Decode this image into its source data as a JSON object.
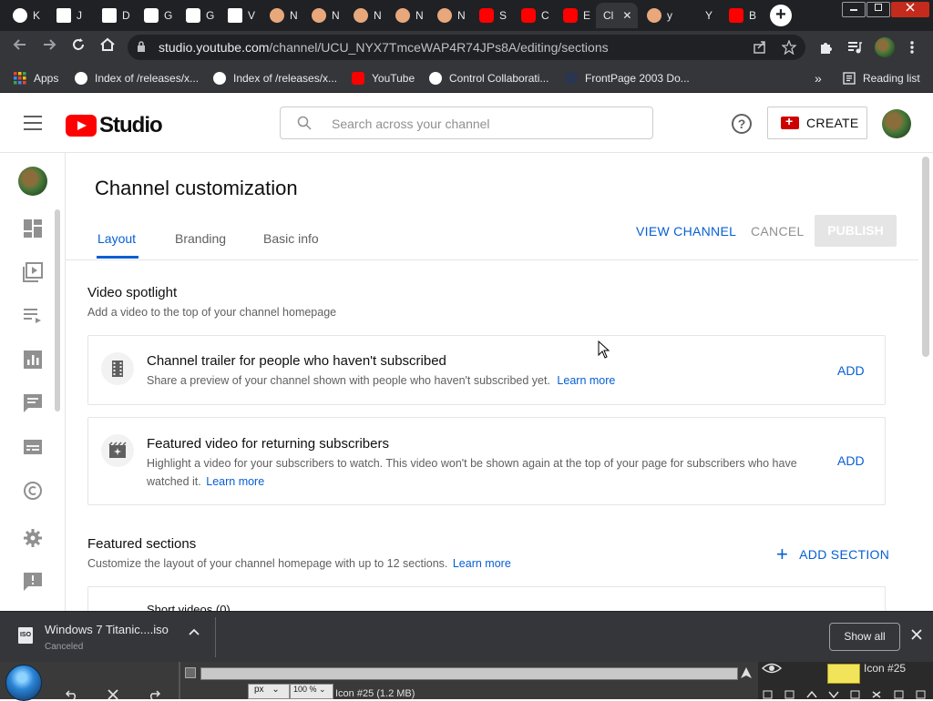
{
  "browser": {
    "tabs": [
      {
        "label": "K",
        "color": "#ffffff"
      },
      {
        "label": "J",
        "color": "#ffffff"
      },
      {
        "label": "D",
        "color": "#ffffff"
      },
      {
        "label": "G",
        "color": "#ffffff"
      },
      {
        "label": "G",
        "color": "#ffffff"
      },
      {
        "label": "V",
        "color": "#ffffff"
      },
      {
        "label": "N",
        "color": "#e8a87c"
      },
      {
        "label": "N",
        "color": "#e8a87c"
      },
      {
        "label": "N",
        "color": "#e8a87c"
      },
      {
        "label": "N",
        "color": "#e8a87c"
      },
      {
        "label": "N",
        "color": "#e8a87c"
      },
      {
        "label": "S",
        "color": "#ff0000"
      },
      {
        "label": "C",
        "color": "#ff0000"
      },
      {
        "label": "E",
        "color": "#ff0000"
      },
      {
        "label": "Cl",
        "color": "#ff0000"
      },
      {
        "label": "y",
        "color": "#e8a87c"
      },
      {
        "label": "Y",
        "color": "#202124"
      },
      {
        "label": "B",
        "color": "#ff0000"
      }
    ],
    "active_tab_close": "✕",
    "new_tab": "+",
    "url_host": "studio.youtube.com",
    "url_path": "/channel/UCU_NYX7TmceWAP4R74JPs8A/editing/sections",
    "bookmarks": [
      {
        "label": "Apps"
      },
      {
        "label": "Index of /releases/x..."
      },
      {
        "label": "Index of /releases/x..."
      },
      {
        "label": "YouTube"
      },
      {
        "label": "Control Collaborati..."
      },
      {
        "label": "FrontPage 2003 Do..."
      }
    ],
    "bookmarks_overflow": "»",
    "reading_list": "Reading list"
  },
  "header": {
    "logo_text": "Studio",
    "search_placeholder": "Search across your channel",
    "help_label": "?",
    "create_label": "CREATE"
  },
  "page": {
    "title": "Channel customization",
    "tabs": [
      {
        "label": "Layout",
        "active": true
      },
      {
        "label": "Branding",
        "active": false
      },
      {
        "label": "Basic info",
        "active": false
      }
    ],
    "view_channel": "VIEW CHANNEL",
    "cancel": "CANCEL",
    "publish": "PUBLISH"
  },
  "spotlight": {
    "title": "Video spotlight",
    "subtitle": "Add a video to the top of your channel homepage",
    "cards": [
      {
        "title": "Channel trailer for people who haven't subscribed",
        "desc": "Share a preview of your channel shown with people who haven't subscribed yet.",
        "link": "Learn more",
        "action": "ADD"
      },
      {
        "title": "Featured video for returning subscribers",
        "desc_line1": "Highlight a video for your subscribers to watch. This video won't be shown again at the top of your page for subscribers who have",
        "desc_line2": "watched it.",
        "link": "Learn more",
        "action": "ADD"
      }
    ]
  },
  "featured": {
    "title": "Featured sections",
    "subtitle": "Customize the layout of your channel homepage with up to 12 sections.",
    "link": "Learn more",
    "add_section": "ADD SECTION",
    "partial_card_title": "Short videos (0)"
  },
  "download": {
    "file_type": "ISO",
    "file_name": "Windows 7 Titanic....iso",
    "status": "Canceled",
    "show_all": "Show all"
  },
  "taskbar": {
    "unit": "px",
    "zoom": "100 %",
    "info": "Icon #25 (1.2 MB)",
    "layer_label": "Icon #25"
  }
}
